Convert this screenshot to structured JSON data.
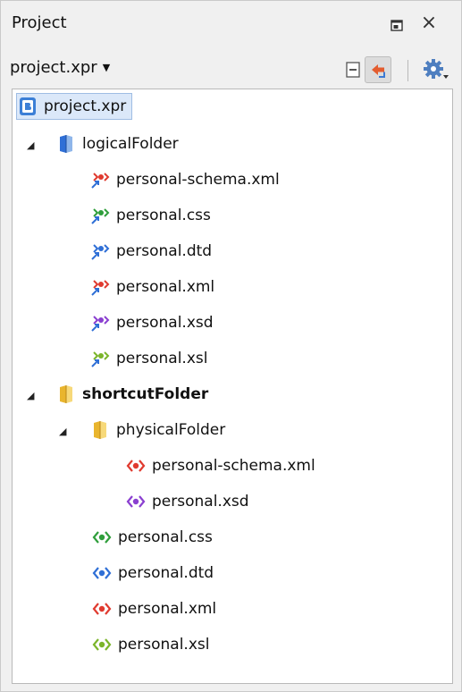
{
  "panel": {
    "title": "Project",
    "close_glyph": "×"
  },
  "toolbar": {
    "project_name": "project.xpr",
    "dropdown_glyph": "▼"
  },
  "tree": {
    "root": {
      "label": "project.xpr",
      "icon": "project-file-icon"
    },
    "logical_folder": {
      "label": "logicalFolder",
      "icon": "logical-folder-icon",
      "expanded": true
    },
    "logical_files": [
      {
        "label": "personal-schema.xml",
        "icon": "linked-schema-xml-icon",
        "color": "#e03a2f"
      },
      {
        "label": "personal.css",
        "icon": "linked-css-icon",
        "color": "#2f9e3b"
      },
      {
        "label": "personal.dtd",
        "icon": "linked-dtd-icon",
        "color": "#2f6fd6"
      },
      {
        "label": "personal.xml",
        "icon": "linked-xml-icon",
        "color": "#e03a2f"
      },
      {
        "label": "personal.xsd",
        "icon": "linked-xsd-icon",
        "color": "#8a3fd0"
      },
      {
        "label": "personal.xsl",
        "icon": "linked-xsl-icon",
        "color": "#7bb52a"
      }
    ],
    "shortcut_folder": {
      "label": "shortcutFolder",
      "icon": "shortcut-folder-icon",
      "expanded": true
    },
    "physical_folder": {
      "label": "physicalFolder",
      "icon": "physical-folder-icon",
      "expanded": true
    },
    "physical_files": [
      {
        "label": "personal-schema.xml",
        "icon": "xml-file-icon",
        "color": "#e03a2f"
      },
      {
        "label": "personal.xsd",
        "icon": "xsd-file-icon",
        "color": "#8a3fd0"
      }
    ],
    "shortcut_files": [
      {
        "label": "personal.css",
        "icon": "css-file-icon",
        "color": "#2f9e3b"
      },
      {
        "label": "personal.dtd",
        "icon": "dtd-file-icon",
        "color": "#2f6fd6"
      },
      {
        "label": "personal.xml",
        "icon": "xml-file-icon",
        "color": "#e03a2f"
      },
      {
        "label": "personal.xsl",
        "icon": "xsl-file-icon",
        "color": "#7bb52a"
      }
    ]
  },
  "colors": {
    "selection_bg": "#dbe8f9",
    "folder_yellow": "#f2c443",
    "project_blue": "#3c7fd6"
  }
}
